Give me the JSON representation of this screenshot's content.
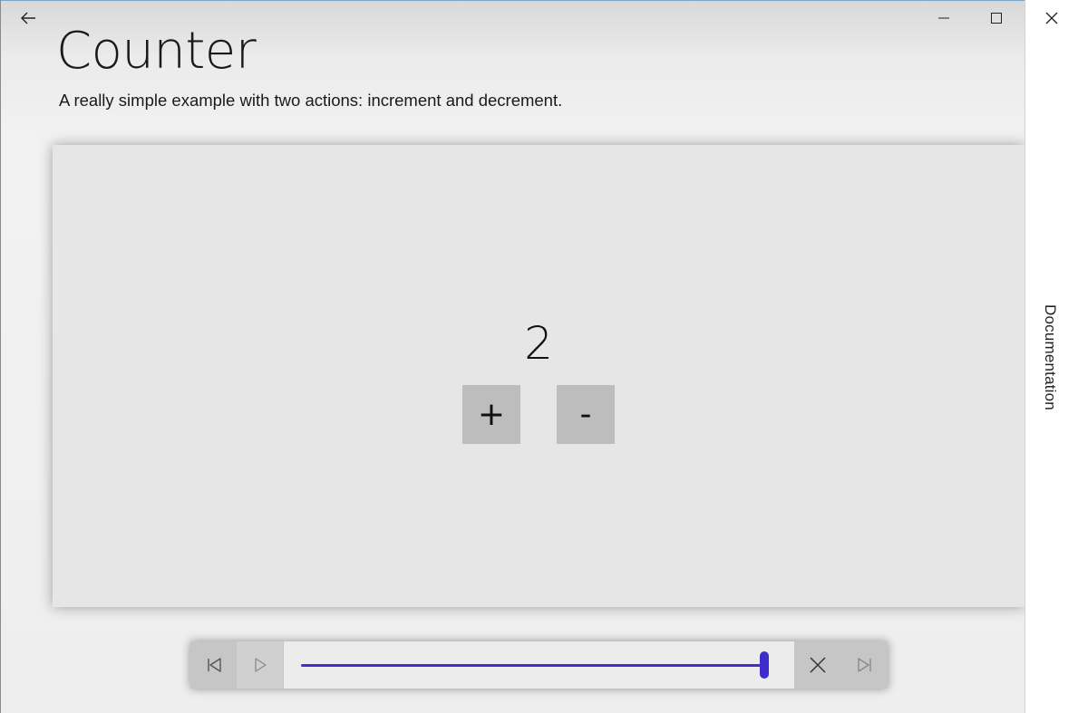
{
  "page": {
    "title": "Counter",
    "subtitle": "A really simple example with two actions: increment and decrement."
  },
  "counter": {
    "value": "2",
    "increment_label": "+",
    "decrement_label": "-"
  },
  "sidebar": {
    "label": "Documentation"
  },
  "player": {
    "position_fraction": 1.0
  },
  "icons": {
    "back": "back-arrow-icon",
    "minimize": "minimize-icon",
    "maximize": "maximize-icon",
    "close": "close-icon",
    "first": "skip-to-start-icon",
    "play": "play-icon",
    "stop": "close-icon",
    "last": "skip-to-end-icon"
  },
  "colors": {
    "accent": "#3f2fd0",
    "panel": "#e6e6e6",
    "button": "#bdbdbd"
  }
}
